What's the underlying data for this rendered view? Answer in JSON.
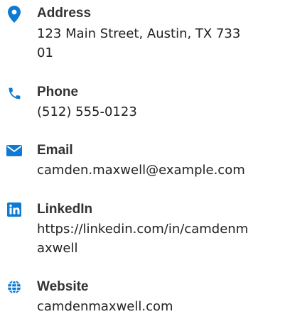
{
  "accent_color": "#0d7bd4",
  "contacts": [
    {
      "icon": "map-pin-icon",
      "label": "Address",
      "value": "123 Main Street, Austin, TX 73301"
    },
    {
      "icon": "phone-icon",
      "label": "Phone",
      "value": "(512) 555-0123"
    },
    {
      "icon": "envelope-icon",
      "label": "Email",
      "value": "camden.maxwell@example.com"
    },
    {
      "icon": "linkedin-icon",
      "label": "LinkedIn",
      "value": "https://linkedin.com/in/camdenmaxwell"
    },
    {
      "icon": "globe-icon",
      "label": "Website",
      "value": "camdenmaxwell.com"
    }
  ]
}
